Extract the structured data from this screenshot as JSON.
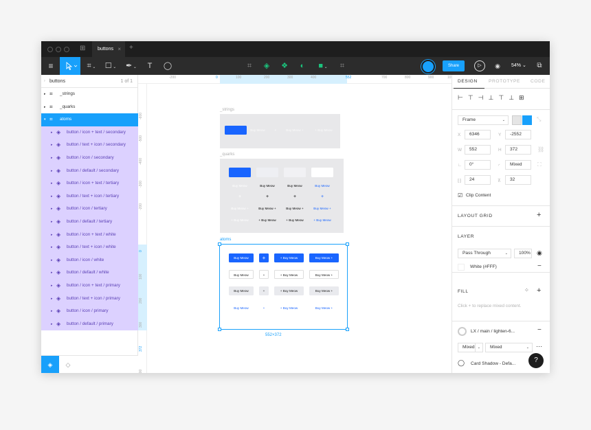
{
  "tabs": {
    "current": "buttons",
    "add": "+"
  },
  "toolbar": {
    "share_label": "Share",
    "zoom": "54% ⌄"
  },
  "pages": {
    "name": "buttons",
    "count": "1 of 1"
  },
  "layers": {
    "items": [
      {
        "label": "_strings"
      },
      {
        "label": "_quarks"
      },
      {
        "label": "atoms"
      },
      {
        "label": "button / icon + text / secondary"
      },
      {
        "label": "button / text + icon / secondary"
      },
      {
        "label": "button / icon / secondary"
      },
      {
        "label": "button / default / secondary"
      },
      {
        "label": "button / icon + text / tertiary"
      },
      {
        "label": "button / text + icon / tertiary"
      },
      {
        "label": "button / icon / tertiary"
      },
      {
        "label": "button / default / tertiary"
      },
      {
        "label": "button / icon + text / white"
      },
      {
        "label": "button / text + icon / white"
      },
      {
        "label": "button / icon / white"
      },
      {
        "label": "button / default / white"
      },
      {
        "label": "button / icon + text / primary"
      },
      {
        "label": "button / text + icon / primary"
      },
      {
        "label": "button / icon / primary"
      },
      {
        "label": "button / default / primary"
      }
    ]
  },
  "rulers": {
    "top": [
      "-200",
      "0",
      "100",
      "200",
      "300",
      "400",
      "552",
      "700",
      "800",
      "900",
      "10"
    ],
    "left": [
      "-600",
      "-500",
      "-400",
      "-300",
      "-200",
      "0",
      "100",
      "200",
      "300",
      "372",
      "500"
    ]
  },
  "canvas": {
    "strings_label": "_strings",
    "quarks_label": "_quarks",
    "atoms_label": "atoms",
    "dimensions": "552×372",
    "button_text": "Buy Meow",
    "icon_text": "+ Buy Meow",
    "text_icon": "Buy Meow +",
    "plus": "+"
  },
  "design": {
    "tabs": [
      "DESIGN",
      "PROTOTYPE",
      "CODE"
    ],
    "frame_type": "Frame",
    "x": "6346",
    "y": "-2552",
    "w": "552",
    "h": "372",
    "rotation": "0°",
    "radius": "Mixed",
    "pad_h": "24",
    "pad_v": "32",
    "clip_content": "Clip Content",
    "layout_grid": "LAYOUT GRID",
    "layer": "LAYER",
    "blend": "Pass Through",
    "opacity": "100%",
    "fill_header": "FILL",
    "fill_swatch": "White (#FFF)",
    "fill_mixed_note": "Click + to replace mixed content.",
    "text_style": "LX / main / lighten-6...",
    "mixed1": "Mixed",
    "mixed2": "Mixed",
    "effect": "Card Shadow - Defa..."
  }
}
